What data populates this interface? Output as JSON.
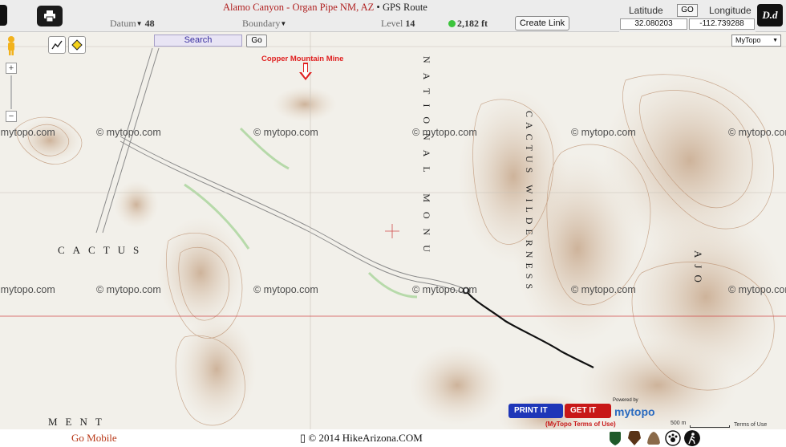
{
  "header": {
    "title_place": "Alamo Canyon - Organ Pipe NM, AZ",
    "title_sep": " • ",
    "title_suffix": "GPS Route",
    "datum_label": "Datum",
    "datum_value": "48",
    "boundary_label": "Boundary",
    "level_label": "Level",
    "level_value": "14",
    "elevation": "2,182 ft",
    "create_link_label": "Create Link"
  },
  "coords": {
    "latitude_label": "Latitude",
    "go_label": "GO",
    "longitude_label": "Longitude",
    "latitude_value": "32.080203",
    "longitude_value": "-112.739288",
    "logo_text": "D.d"
  },
  "map": {
    "search_placeholder": "Search",
    "search_go_label": "Go",
    "map_type": "MyTopo",
    "poi_label": "Copper Mountain Mine",
    "watermark": "© mytopo.com",
    "region_cactus": "CACTUS",
    "region_ajo": "AJO",
    "region_ment": "MENT",
    "region_wilderness": "CACTUS WILDERNESS",
    "region_national": "NATIONAL MONU",
    "print_label": "PRINT IT",
    "get_label": "GET IT",
    "terms_label": "(MyTopo Terms of Use)",
    "powered_label": "Powered by",
    "mytopo_logo": "mytopo",
    "scale_label": "500 m",
    "terms2_label": "Terms of Use"
  },
  "footer": {
    "go_mobile": "Go Mobile",
    "copyright": "© 2014 HikeArizona.COM"
  },
  "colors": {
    "route": "#111111",
    "poi": "#e02020",
    "township_line": "#d04a4a",
    "contour": "#b88a68"
  }
}
